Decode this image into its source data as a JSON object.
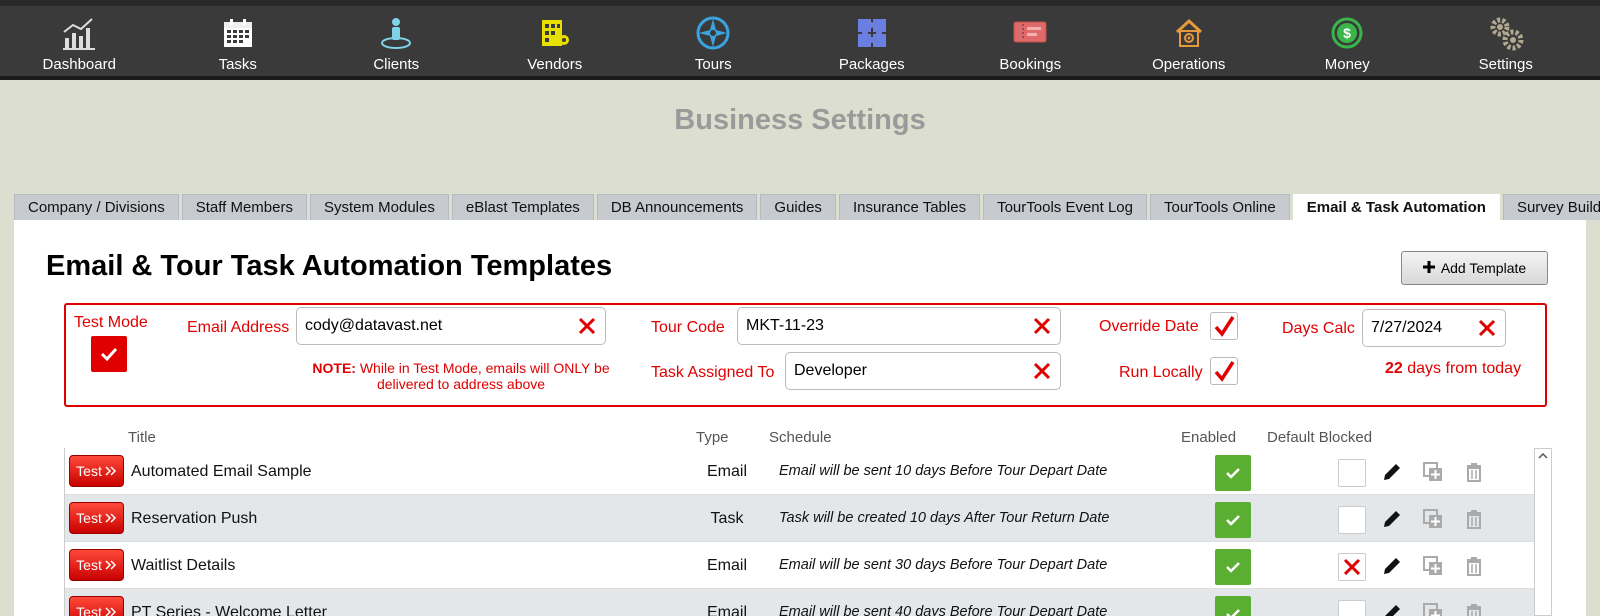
{
  "nav": [
    {
      "label": "Dashboard",
      "icon": "chart-icon"
    },
    {
      "label": "Tasks",
      "icon": "calendar-icon"
    },
    {
      "label": "Clients",
      "icon": "person-icon"
    },
    {
      "label": "Vendors",
      "icon": "building-icon"
    },
    {
      "label": "Tours",
      "icon": "compass-icon"
    },
    {
      "label": "Packages",
      "icon": "puzzle-icon"
    },
    {
      "label": "Bookings",
      "icon": "ticket-icon"
    },
    {
      "label": "Operations",
      "icon": "house-gear-icon"
    },
    {
      "label": "Money",
      "icon": "money-icon"
    },
    {
      "label": "Settings",
      "icon": "gear-icon"
    }
  ],
  "page_title": "Business Settings",
  "tabs": [
    {
      "label": "Company / Divisions",
      "active": false
    },
    {
      "label": "Staff Members",
      "active": false
    },
    {
      "label": "System Modules",
      "active": false
    },
    {
      "label": "eBlast Templates",
      "active": false
    },
    {
      "label": "DB Announcements",
      "active": false
    },
    {
      "label": "Guides",
      "active": false
    },
    {
      "label": "Insurance Tables",
      "active": false
    },
    {
      "label": "TourTools Event Log",
      "active": false
    },
    {
      "label": "TourTools Online",
      "active": false
    },
    {
      "label": "Email & Task Automation",
      "active": true
    },
    {
      "label": "Survey Builder",
      "active": false
    }
  ],
  "main_title": "Email & Tour Task Automation Templates",
  "add_button": "Add Template",
  "test_settings": {
    "test_mode_label": "Test Mode",
    "test_mode_checked": true,
    "email_label": "Email Address",
    "email_value": "cody@datavast.net",
    "note_strong": "NOTE:",
    "note_text": "While in Test Mode, emails will ONLY be delivered to address above",
    "tour_code_label": "Tour Code",
    "tour_code_value": "MKT-11-23",
    "task_assigned_label": "Task Assigned To",
    "task_assigned_value": "Developer",
    "override_date_label": "Override Date",
    "override_date_checked": true,
    "run_locally_label": "Run Locally",
    "run_locally_checked": true,
    "days_calc_label": "Days Calc",
    "days_calc_value": "7/27/2024",
    "days_count": "22",
    "days_suffix": "days from today"
  },
  "colors": {
    "accent_red": "#e00000",
    "enabled_green": "#5aae32",
    "nav_bg": "#3a3a3a"
  },
  "table": {
    "headers": {
      "title": "Title",
      "type": "Type",
      "schedule": "Schedule",
      "enabled": "Enabled",
      "default_blocked": "Default Blocked"
    },
    "test_button_label": "Test",
    "rows": [
      {
        "title": "Automated Email Sample",
        "type": "Email",
        "schedule": "Email will be sent 10 days Before Tour Depart Date",
        "enabled": true,
        "blocked": false
      },
      {
        "title": "Reservation Push",
        "type": "Task",
        "schedule": "Task will be created 10 days After Tour Return Date",
        "enabled": true,
        "blocked": false
      },
      {
        "title": "Waitlist Details",
        "type": "Email",
        "schedule": "Email will be sent 30 days Before Tour Depart Date",
        "enabled": true,
        "blocked": true
      },
      {
        "title": "PT Series - Welcome Letter",
        "type": "Email",
        "schedule": "Email will be sent 40 days Before Tour Depart Date",
        "enabled": true,
        "blocked": false
      }
    ]
  }
}
